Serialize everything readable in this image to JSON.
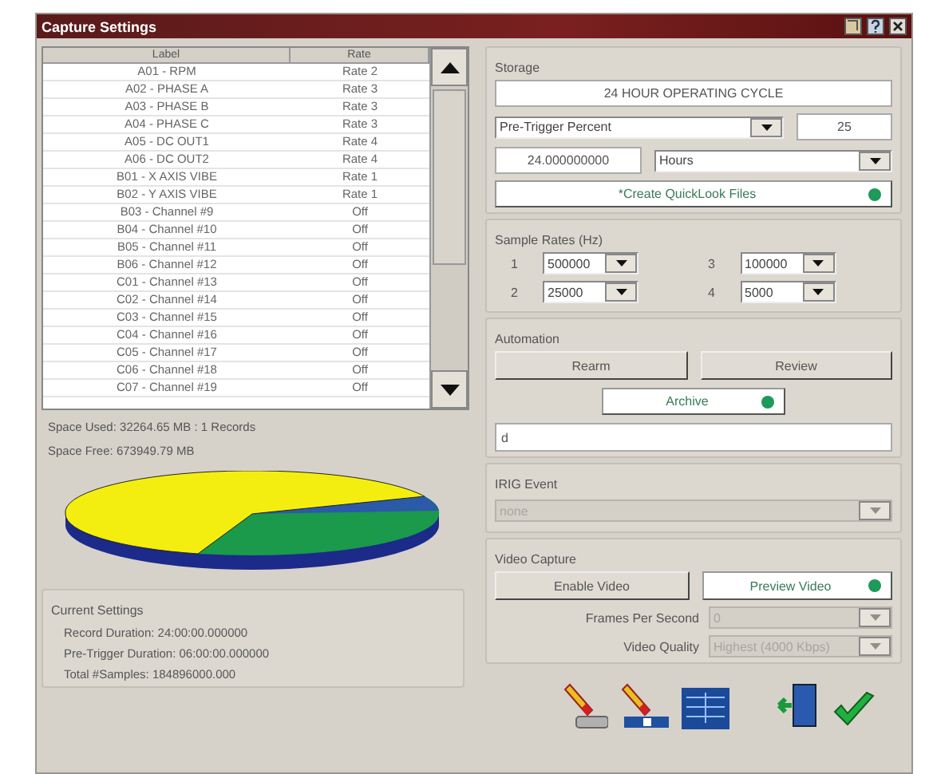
{
  "window": {
    "title": "Capture Settings"
  },
  "channel_table": {
    "columns": [
      "Label",
      "Rate"
    ],
    "rows": [
      {
        "label": "A01 - RPM",
        "rate": "Rate 2"
      },
      {
        "label": "A02 - PHASE A",
        "rate": "Rate 3"
      },
      {
        "label": "A03 - PHASE B",
        "rate": "Rate 3"
      },
      {
        "label": "A04 - PHASE C",
        "rate": "Rate 3"
      },
      {
        "label": "A05 - DC OUT1",
        "rate": "Rate 4"
      },
      {
        "label": "A06 - DC OUT2",
        "rate": "Rate 4"
      },
      {
        "label": "B01 - X AXIS VIBE",
        "rate": "Rate 1"
      },
      {
        "label": "B02 - Y AXIS VIBE",
        "rate": "Rate 1"
      },
      {
        "label": "B03 - Channel #9",
        "rate": "Off"
      },
      {
        "label": "B04 - Channel #10",
        "rate": "Off"
      },
      {
        "label": "B05 - Channel #11",
        "rate": "Off"
      },
      {
        "label": "B06 - Channel #12",
        "rate": "Off"
      },
      {
        "label": "C01 - Channel #13",
        "rate": "Off"
      },
      {
        "label": "C02 - Channel #14",
        "rate": "Off"
      },
      {
        "label": "C03 - Channel #15",
        "rate": "Off"
      },
      {
        "label": "C04 - Channel #16",
        "rate": "Off"
      },
      {
        "label": "C05 - Channel #17",
        "rate": "Off"
      },
      {
        "label": "C06 - Channel #18",
        "rate": "Off"
      },
      {
        "label": "C07 - Channel #19",
        "rate": "Off"
      }
    ]
  },
  "space_used": "Space Used: 32264.65 MB : 1 Records",
  "space_free": "Space Free: 673949.79 MB",
  "current_settings": {
    "title": "Current Settings",
    "lines": [
      "Record Duration: 24:00:00.000000",
      "Pre-Trigger Duration: 06:00:00.000000",
      "Total #Samples: 184896000.000"
    ]
  },
  "storage": {
    "title": "Storage",
    "name": "24 HOUR OPERATING CYCLE",
    "mode": {
      "value": "Pre-Trigger Percent",
      "disabled": false
    },
    "percent": "25",
    "duration": "24.000000000",
    "unit": {
      "value": "Hours",
      "disabled": false
    },
    "quicklook": {
      "label": "*Create QuickLook Files",
      "on": true
    }
  },
  "sample_rates": {
    "title": "Sample Rates (Hz)",
    "rates": [
      {
        "index": "1",
        "value": "500000",
        "disabled": false
      },
      {
        "index": "3",
        "value": "100000",
        "disabled": false
      },
      {
        "index": "2",
        "value": "25000",
        "disabled": false
      },
      {
        "index": "4",
        "value": "5000",
        "disabled": false
      }
    ]
  },
  "automation": {
    "title": "Automation",
    "buttons": [
      "Rearm",
      "Review"
    ],
    "archive": {
      "label": "Archive",
      "on": true
    },
    "path": "d"
  },
  "irig_event": {
    "title": "IRIG Event",
    "value": "none",
    "disabled": true
  },
  "video_capture": {
    "title": "Video Capture",
    "enable_button": "Enable Video",
    "preview": {
      "label": "Preview Video",
      "on": true
    },
    "fields": [
      {
        "label": "Frames Per Second",
        "value": "0",
        "disabled": true
      },
      {
        "label": "Video Quality",
        "value": "Highest (4000 Kbps)",
        "disabled": true
      }
    ]
  }
}
